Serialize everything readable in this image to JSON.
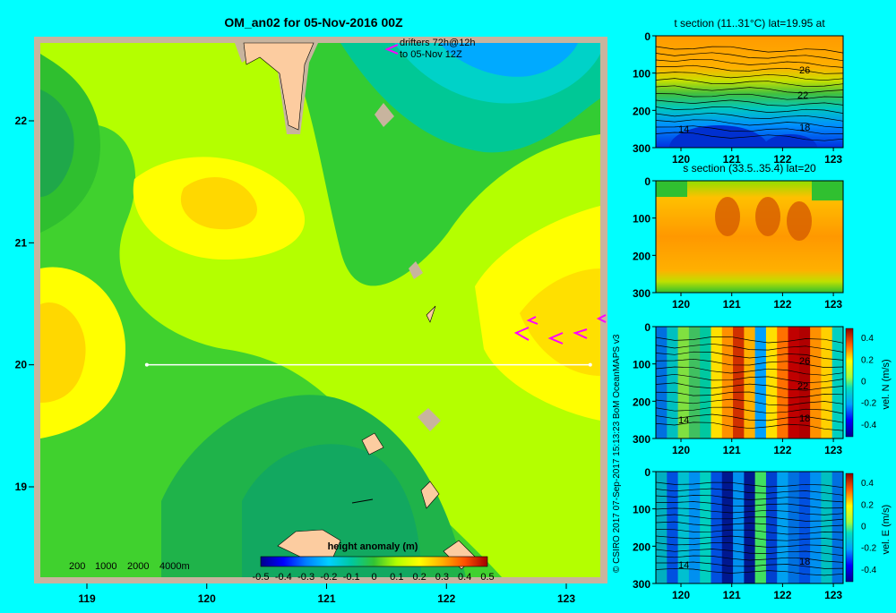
{
  "figure": {
    "title": "OM_an02 for 05-Nov-2016 00Z",
    "credit": "© CSIRO 2017   07-Sep-2017 15:13:23 BoM OceanMAPS v3",
    "background": "#00ffff"
  },
  "main_map": {
    "drifters_label_line1": "drifters 72h@12h",
    "drifters_label_line2": "to 05-Nov 12Z",
    "depth_legend": [
      "200",
      "1000",
      "2000",
      "4000m"
    ],
    "lon_ticks": [
      "119",
      "120",
      "121",
      "122",
      "123"
    ],
    "lat_ticks": [
      "22",
      "21",
      "20",
      "19"
    ],
    "section_line_lat": 20,
    "section_line_lon_range": [
      119.5,
      123.2
    ],
    "colorbar": {
      "title": "height anomaly (m)",
      "labels": [
        "-0.5",
        "-0.4",
        "-0.3",
        "-0.2",
        "-0.1",
        "0",
        "0.1",
        "0.2",
        "0.3",
        "0.4",
        "0.5"
      ],
      "range": [
        -0.5,
        0.5
      ]
    },
    "land_color": "#fccca0",
    "shelf_color": "#c8b49e",
    "drifter_color": "#ff00ff",
    "section_line_color": "#ffffff"
  },
  "panels": [
    {
      "title": "t section (11..31°C) lat=19.95 at",
      "y_ticks": [
        "0",
        "100",
        "200",
        "300"
      ],
      "x_ticks": [
        "120",
        "121",
        "122",
        "123"
      ],
      "contour_labels": [
        "26",
        "22",
        "18",
        "14"
      ]
    },
    {
      "title": "s section (33.5..35.4) lat=20",
      "y_ticks": [
        "0",
        "100",
        "200",
        "300"
      ],
      "x_ticks": [
        "120",
        "121",
        "122",
        "123"
      ]
    },
    {
      "title": "",
      "y_ticks": [
        "0",
        "100",
        "200",
        "300"
      ],
      "x_ticks": [
        "120",
        "121",
        "122",
        "123"
      ],
      "contour_labels": [
        "26",
        "22",
        "18",
        "14"
      ],
      "colorbar_label": "vel. N (m/s)",
      "colorbar_ticks": [
        "0.4",
        "0.2",
        "0",
        "-0.2",
        "-0.4"
      ]
    },
    {
      "title": "",
      "y_ticks": [
        "0",
        "100",
        "200",
        "300"
      ],
      "x_ticks": [
        "120",
        "121",
        "122",
        "123"
      ],
      "contour_labels": [
        "14",
        "18"
      ],
      "colorbar_label": "vel. E (m/s)",
      "colorbar_ticks": [
        "0.4",
        "0.2",
        "0",
        "-0.2",
        "-0.4"
      ]
    }
  ]
}
